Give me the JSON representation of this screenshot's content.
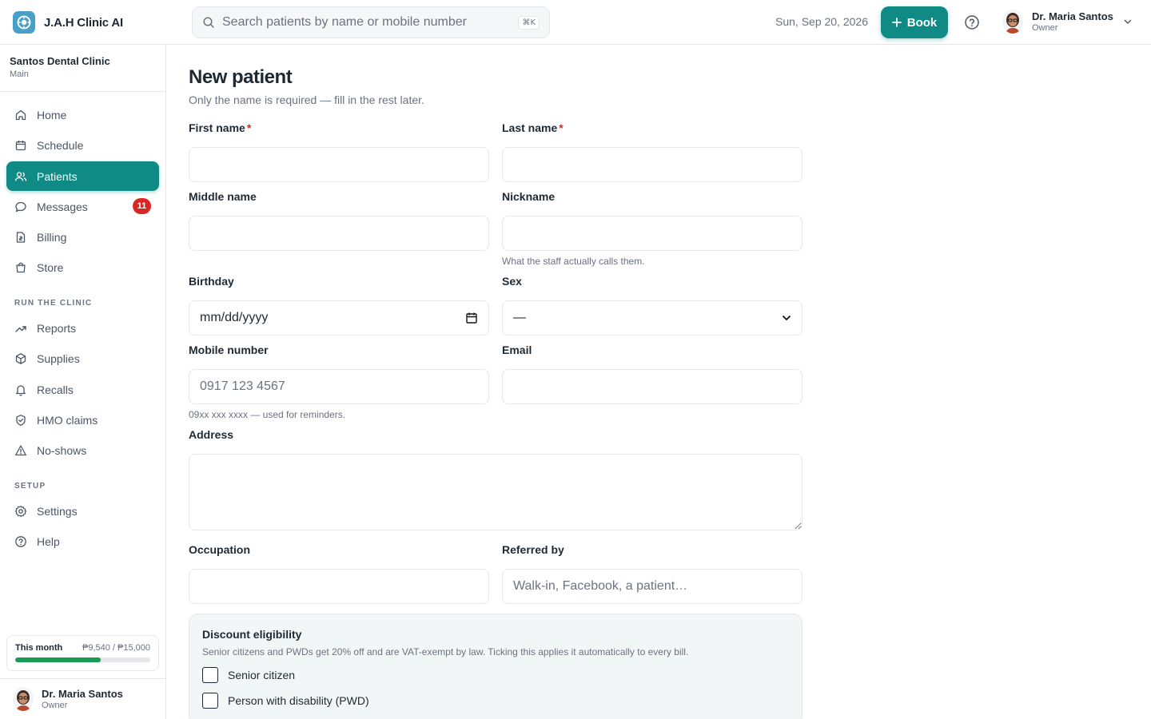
{
  "app": {
    "name": "J.A.H Clinic AI"
  },
  "header": {
    "search_placeholder": "Search patients by name or mobile number",
    "search_shortcut": "⌘K",
    "date": "Sun, Sep 20, 2026",
    "book_label": "Book",
    "user_name": "Dr. Maria Santos",
    "user_role": "Owner"
  },
  "sidebar": {
    "clinic_name": "Santos Dental Clinic",
    "clinic_branch": "Main",
    "items": [
      {
        "label": "Home",
        "icon": "home-icon"
      },
      {
        "label": "Schedule",
        "icon": "calendar-icon"
      },
      {
        "label": "Patients",
        "icon": "users-icon",
        "active": true
      },
      {
        "label": "Messages",
        "icon": "message-icon",
        "badge": "11"
      },
      {
        "label": "Billing",
        "icon": "receipt-icon"
      },
      {
        "label": "Store",
        "icon": "shopping-bag-icon"
      }
    ],
    "section_run": "RUN THE CLINIC",
    "run_items": [
      {
        "label": "Reports",
        "icon": "trending-up-icon"
      },
      {
        "label": "Supplies",
        "icon": "box-icon"
      },
      {
        "label": "Recalls",
        "icon": "bell-icon"
      },
      {
        "label": "HMO claims",
        "icon": "shield-icon"
      },
      {
        "label": "No-shows",
        "icon": "alert-triangle-icon"
      }
    ],
    "section_setup": "SETUP",
    "setup_items": [
      {
        "label": "Settings",
        "icon": "gear-icon"
      },
      {
        "label": "Help",
        "icon": "help-circle-icon"
      }
    ],
    "month": {
      "label": "This month",
      "value": "₱9,540 / ₱15,000",
      "progress": 0.636
    },
    "user_name": "Dr. Maria Santos",
    "user_role": "Owner"
  },
  "form": {
    "title": "New patient",
    "subtitle": "Only the name is required — fill in the rest later.",
    "first_name": {
      "label": "First name",
      "required_mark": "*",
      "value": ""
    },
    "last_name": {
      "label": "Last name",
      "required_mark": "*",
      "value": ""
    },
    "middle_name": {
      "label": "Middle name",
      "value": ""
    },
    "nickname": {
      "label": "Nickname",
      "value": "",
      "hint": "What the staff actually calls them."
    },
    "birthday": {
      "label": "Birthday",
      "placeholder": "mm/dd/yyyy"
    },
    "sex": {
      "label": "Sex",
      "selected": "—"
    },
    "mobile": {
      "label": "Mobile number",
      "placeholder": "0917 123 4567",
      "hint": "09xx xxx xxxx — used for reminders."
    },
    "email": {
      "label": "Email",
      "value": ""
    },
    "address": {
      "label": "Address",
      "value": ""
    },
    "occupation": {
      "label": "Occupation",
      "value": ""
    },
    "referred_by": {
      "label": "Referred by",
      "placeholder": "Walk-in, Facebook, a patient…"
    },
    "discount": {
      "title": "Discount eligibility",
      "subtitle": "Senior citizens and PWDs get 20% off and are VAT-exempt by law. Ticking this applies it automatically to every bill.",
      "senior_label": "Senior citizen",
      "pwd_label": "Person with disability (PWD)"
    }
  },
  "colors": {
    "accent": "#0f8a84",
    "badge": "#dc2626",
    "progress": "#169a54",
    "logo": "#4a9fc9"
  }
}
